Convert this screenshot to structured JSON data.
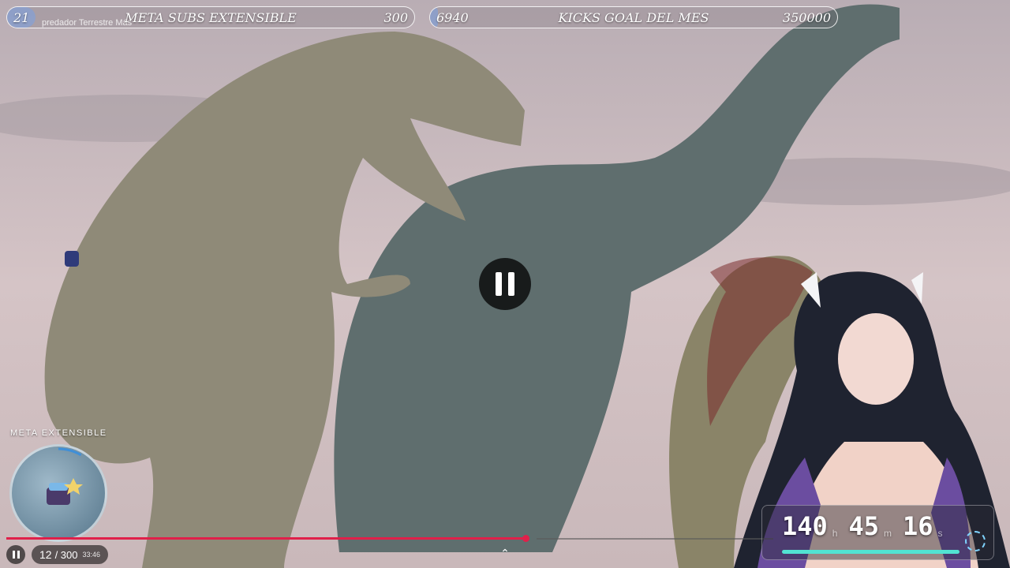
{
  "overlay": {
    "subs_goal": {
      "current": "21",
      "title": "META SUBS EXTENSIBLE",
      "target": "300",
      "progress": 0.07
    },
    "kicks_goal": {
      "current": "6940",
      "title": "KICKS GOAL DEL MES",
      "target": "350000",
      "progress": 0.02
    },
    "video_title": "predador Terrestre Más",
    "meta_label": "META EXTENSIBLE"
  },
  "player": {
    "counter_current": "12",
    "counter_total": "/ 300",
    "time": "33:46",
    "progress": 0.52
  },
  "countdown": {
    "hours": "140",
    "hours_unit": "h",
    "minutes": "45",
    "minutes_unit": "m",
    "seconds": "16",
    "seconds_unit": "s"
  },
  "colors": {
    "timeline": "#e0204a",
    "countdown_bar": "#52e3d2"
  }
}
